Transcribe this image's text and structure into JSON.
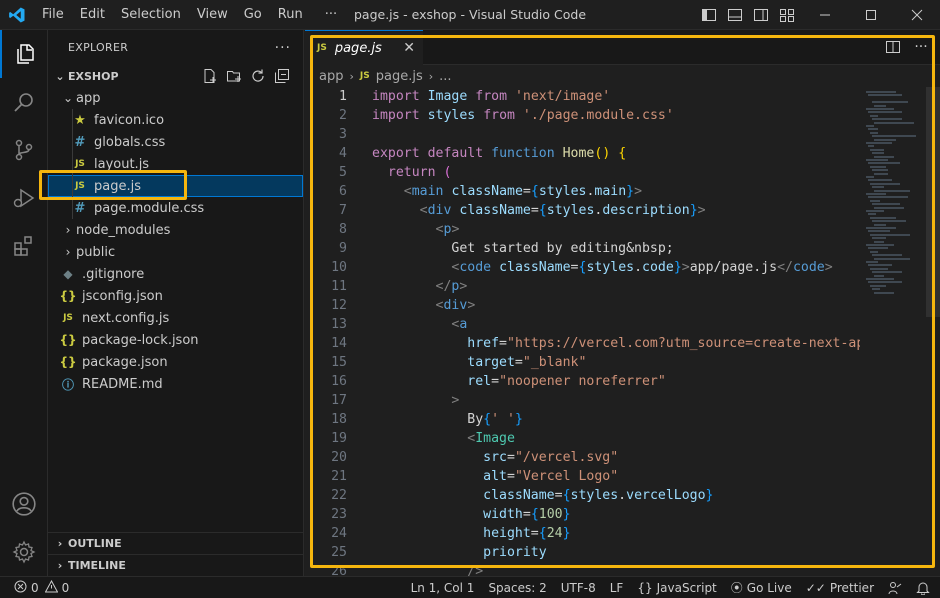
{
  "window": {
    "title": "page.js - exshop - Visual Studio Code",
    "menu": [
      "File",
      "Edit",
      "Selection",
      "View",
      "Go",
      "Run",
      "···"
    ]
  },
  "sidebar": {
    "title": "EXPLORER",
    "more": "···",
    "root": "EXSHOP",
    "tree": [
      {
        "label": "app",
        "type": "folder-open",
        "depth": 1
      },
      {
        "label": "favicon.ico",
        "type": "star",
        "depth": 2
      },
      {
        "label": "globals.css",
        "type": "css",
        "depth": 2
      },
      {
        "label": "layout.js",
        "type": "js",
        "depth": 2
      },
      {
        "label": "page.js",
        "type": "js",
        "depth": 2,
        "selected": true
      },
      {
        "label": "page.module.css",
        "type": "css",
        "depth": 2
      },
      {
        "label": "node_modules",
        "type": "folder",
        "depth": 1
      },
      {
        "label": "public",
        "type": "folder",
        "depth": 1
      },
      {
        "label": ".gitignore",
        "type": "git",
        "depth": 1
      },
      {
        "label": "jsconfig.json",
        "type": "json",
        "depth": 1
      },
      {
        "label": "next.config.js",
        "type": "js",
        "depth": 1
      },
      {
        "label": "package-lock.json",
        "type": "json",
        "depth": 1
      },
      {
        "label": "package.json",
        "type": "json",
        "depth": 1
      },
      {
        "label": "README.md",
        "type": "info",
        "depth": 1
      }
    ],
    "outline": "OUTLINE",
    "timeline": "TIMELINE"
  },
  "editor": {
    "tab_label": "page.js",
    "breadcrumb": [
      "app",
      "page.js",
      "..."
    ],
    "file_badge": "JS",
    "current_line": 1
  },
  "statusbar": {
    "errors": "0",
    "warnings": "0",
    "position": "Ln 1, Col 1",
    "spaces": "Spaces: 2",
    "encoding": "UTF-8",
    "eol": "LF",
    "language": "JavaScript",
    "golive": "Go Live",
    "prettier": "Prettier"
  },
  "colors": {
    "accent": "#0078d4",
    "highlight": "#f5b60e",
    "js_icon": "#cbcb41",
    "css_icon": "#519aba"
  }
}
